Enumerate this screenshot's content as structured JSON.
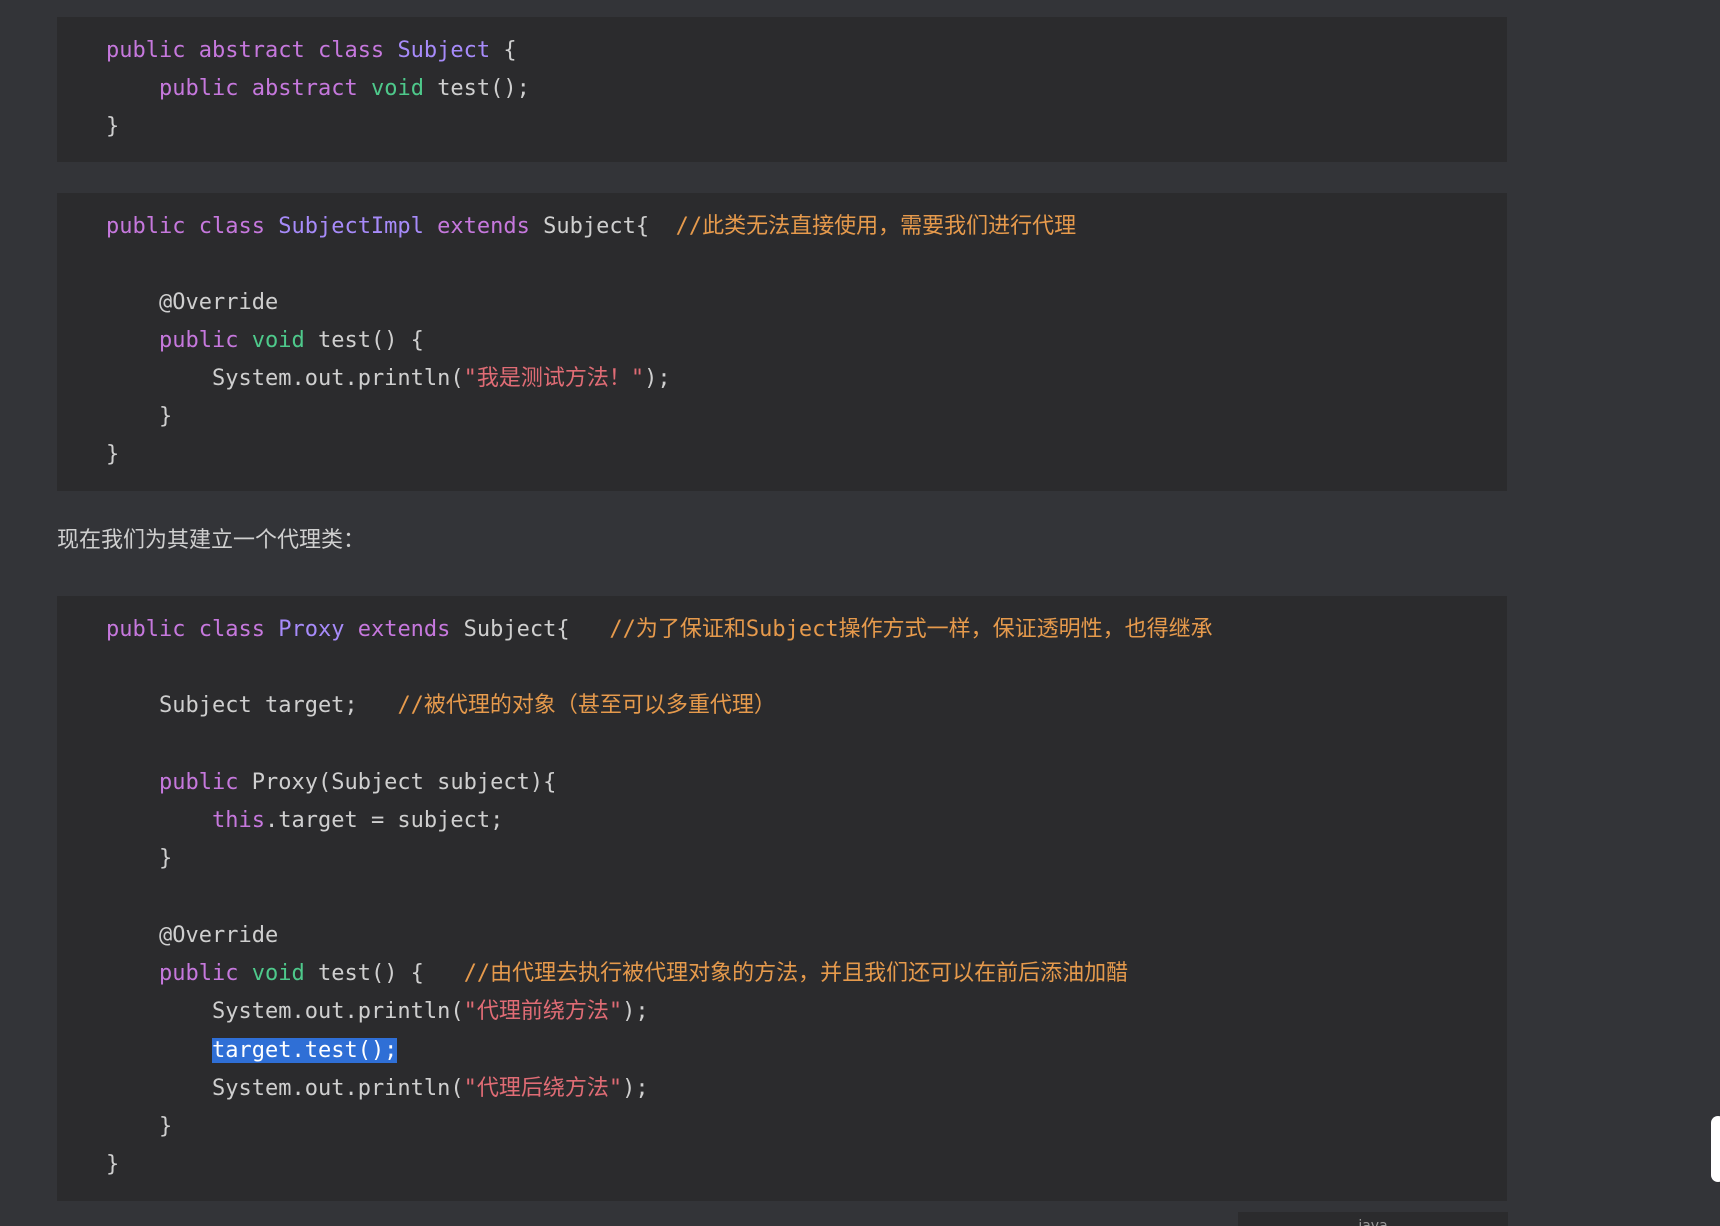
{
  "block1": {
    "line1": [
      "public",
      "abstract",
      "class",
      "Subject",
      "{"
    ],
    "line2": [
      "public",
      "abstract",
      "void",
      "test();"
    ],
    "line3": "}"
  },
  "block2": {
    "line1": [
      "public",
      "class",
      "SubjectImpl",
      "extends",
      "Subject{",
      "//此类无法直接使用，需要我们进行代理"
    ],
    "line3": "@Override",
    "line4": [
      "public",
      "void",
      "test() {"
    ],
    "line5": [
      "System.out.println(",
      "\"我是测试方法！\"",
      ");"
    ],
    "line6": "}",
    "line7": "}"
  },
  "prose": "现在我们为其建立一个代理类：",
  "block3": {
    "line1": [
      "public",
      "class",
      "Proxy",
      "extends",
      "Subject{",
      "//为了保证和Subject操作方式一样，保证透明性，也得继承"
    ],
    "line3": [
      "Subject target;",
      "//被代理的对象（甚至可以多重代理）"
    ],
    "line5": [
      "public",
      "Proxy(Subject subject){"
    ],
    "line6": [
      "this",
      ".target = subject;"
    ],
    "line7": "}",
    "line9": "@Override",
    "line10": [
      "public",
      "void",
      "test() {",
      "//由代理去执行被代理对象的方法，并且我们还可以在前后添油加醋"
    ],
    "line11": [
      "System.out.println(",
      "\"代理前绕方法\"",
      ");"
    ],
    "line12": "target.test();",
    "line13": [
      "System.out.println(",
      "\"代理后绕方法\"",
      ");"
    ],
    "line14": "}",
    "line15": "}"
  },
  "lang_tag": "java",
  "colors": {
    "background": "#333438",
    "code_background": "#2b2b2d",
    "keyword": "#c678dd",
    "type": "#4ec98b",
    "class_name": "#a78bfa",
    "string": "#e06c75",
    "comment": "#e69a4c",
    "selection": "#2f6fd6"
  }
}
